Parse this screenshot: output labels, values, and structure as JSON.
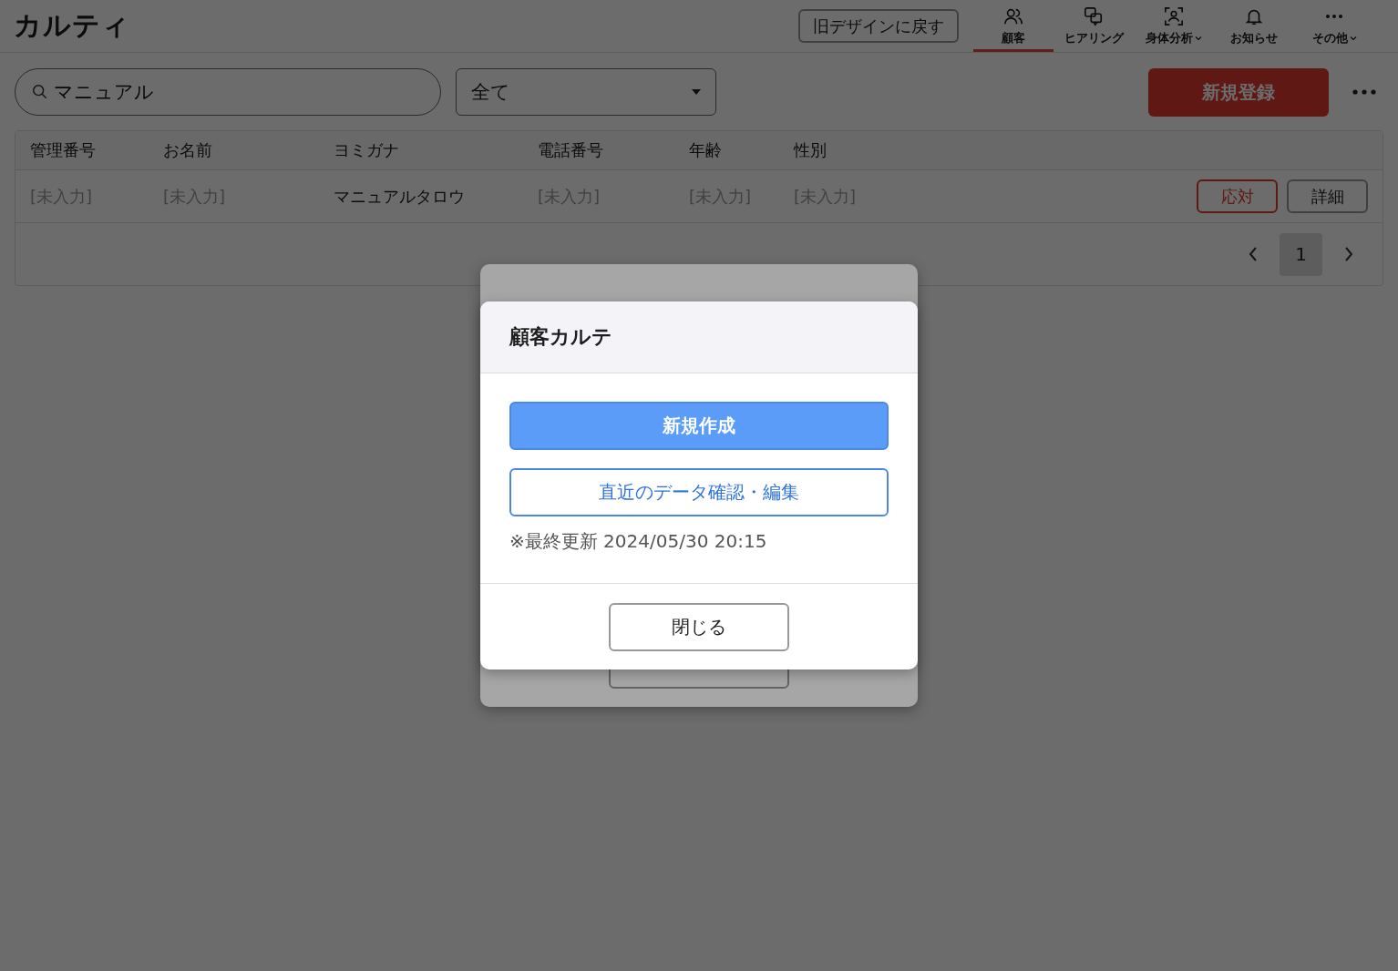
{
  "header": {
    "logo": "カルティ",
    "old_design_button": "旧デザインに戻す",
    "nav": [
      {
        "label": "顧客",
        "selected": true,
        "dropdown": false
      },
      {
        "label": "ヒアリング",
        "selected": false,
        "dropdown": false
      },
      {
        "label": "身体分析",
        "selected": false,
        "dropdown": true
      },
      {
        "label": "お知らせ",
        "selected": false,
        "dropdown": false
      },
      {
        "label": "その他",
        "selected": false,
        "dropdown": true
      }
    ]
  },
  "toolbar": {
    "search": {
      "value": "マニュアル"
    },
    "filter": {
      "value": "全て"
    },
    "new_button": "新規登録"
  },
  "table": {
    "columns": [
      "管理番号",
      "お名前",
      "ヨミガナ",
      "電話番号",
      "年齢",
      "性別"
    ],
    "rows": [
      {
        "cells": [
          {
            "text": "[未入力]",
            "empty": true
          },
          {
            "text": "[未入力]",
            "empty": true
          },
          {
            "text": "マニュアルタロウ",
            "empty": false
          },
          {
            "text": "[未入力]",
            "empty": true
          },
          {
            "text": "[未入力]",
            "empty": true
          },
          {
            "text": "[未入力]",
            "empty": true
          }
        ],
        "actions": [
          {
            "label": "応対",
            "kind": "danger"
          },
          {
            "label": "詳細",
            "kind": "plain"
          }
        ]
      }
    ],
    "pagination": {
      "pages": [
        {
          "label": "1",
          "selected": true
        }
      ]
    }
  },
  "dialog": {
    "title": "顧客カルテ",
    "primary_button": "新規作成",
    "secondary_button": "直近のデータ確認・編集",
    "note": "※最終更新 2024/05/30 20:15",
    "close_button": "閉じる"
  }
}
